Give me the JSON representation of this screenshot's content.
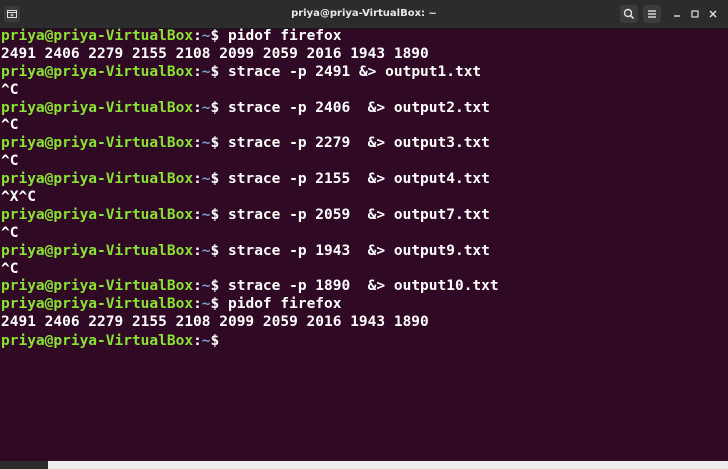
{
  "window": {
    "title": "priya@priya-VirtualBox: ~"
  },
  "icons": {
    "new_tab": "new-tab-icon",
    "search": "search-icon",
    "menu": "hamburger-menu-icon",
    "minimize": "minimize-icon",
    "maximize": "maximize-icon",
    "close": "close-icon"
  },
  "colors": {
    "background": "#300a24",
    "prompt_user": "#8ae234",
    "prompt_path": "#729fcf",
    "text": "#ffffff",
    "titlebar": "#2c2c2c"
  },
  "prompt": {
    "user": "priya@priya-VirtualBox",
    "sep": ":",
    "path": "~",
    "symbol": "$ "
  },
  "terminal": {
    "lines": [
      {
        "type": "cmd",
        "text": "pidof firefox"
      },
      {
        "type": "out",
        "text": "2491 2406 2279 2155 2108 2099 2059 2016 1943 1890"
      },
      {
        "type": "cmd",
        "text": "strace -p 2491 &> output1.txt"
      },
      {
        "type": "out",
        "text": "^C"
      },
      {
        "type": "cmd",
        "text": "strace -p 2406  &> output2.txt"
      },
      {
        "type": "out",
        "text": "^C"
      },
      {
        "type": "cmd",
        "text": "strace -p 2279  &> output3.txt"
      },
      {
        "type": "out",
        "text": "^C"
      },
      {
        "type": "cmd",
        "text": "strace -p 2155  &> output4.txt"
      },
      {
        "type": "out",
        "text": "^X^C"
      },
      {
        "type": "cmd",
        "text": "strace -p 2059  &> output7.txt"
      },
      {
        "type": "out",
        "text": "^C"
      },
      {
        "type": "cmd",
        "text": "strace -p 1943  &> output9.txt"
      },
      {
        "type": "out",
        "text": "^C"
      },
      {
        "type": "cmd",
        "text": "strace -p 1890  &> output10.txt"
      },
      {
        "type": "cmd",
        "text": "pidof firefox"
      },
      {
        "type": "out",
        "text": "2491 2406 2279 2155 2108 2099 2059 2016 1943 1890"
      },
      {
        "type": "cmd",
        "text": ""
      }
    ]
  }
}
